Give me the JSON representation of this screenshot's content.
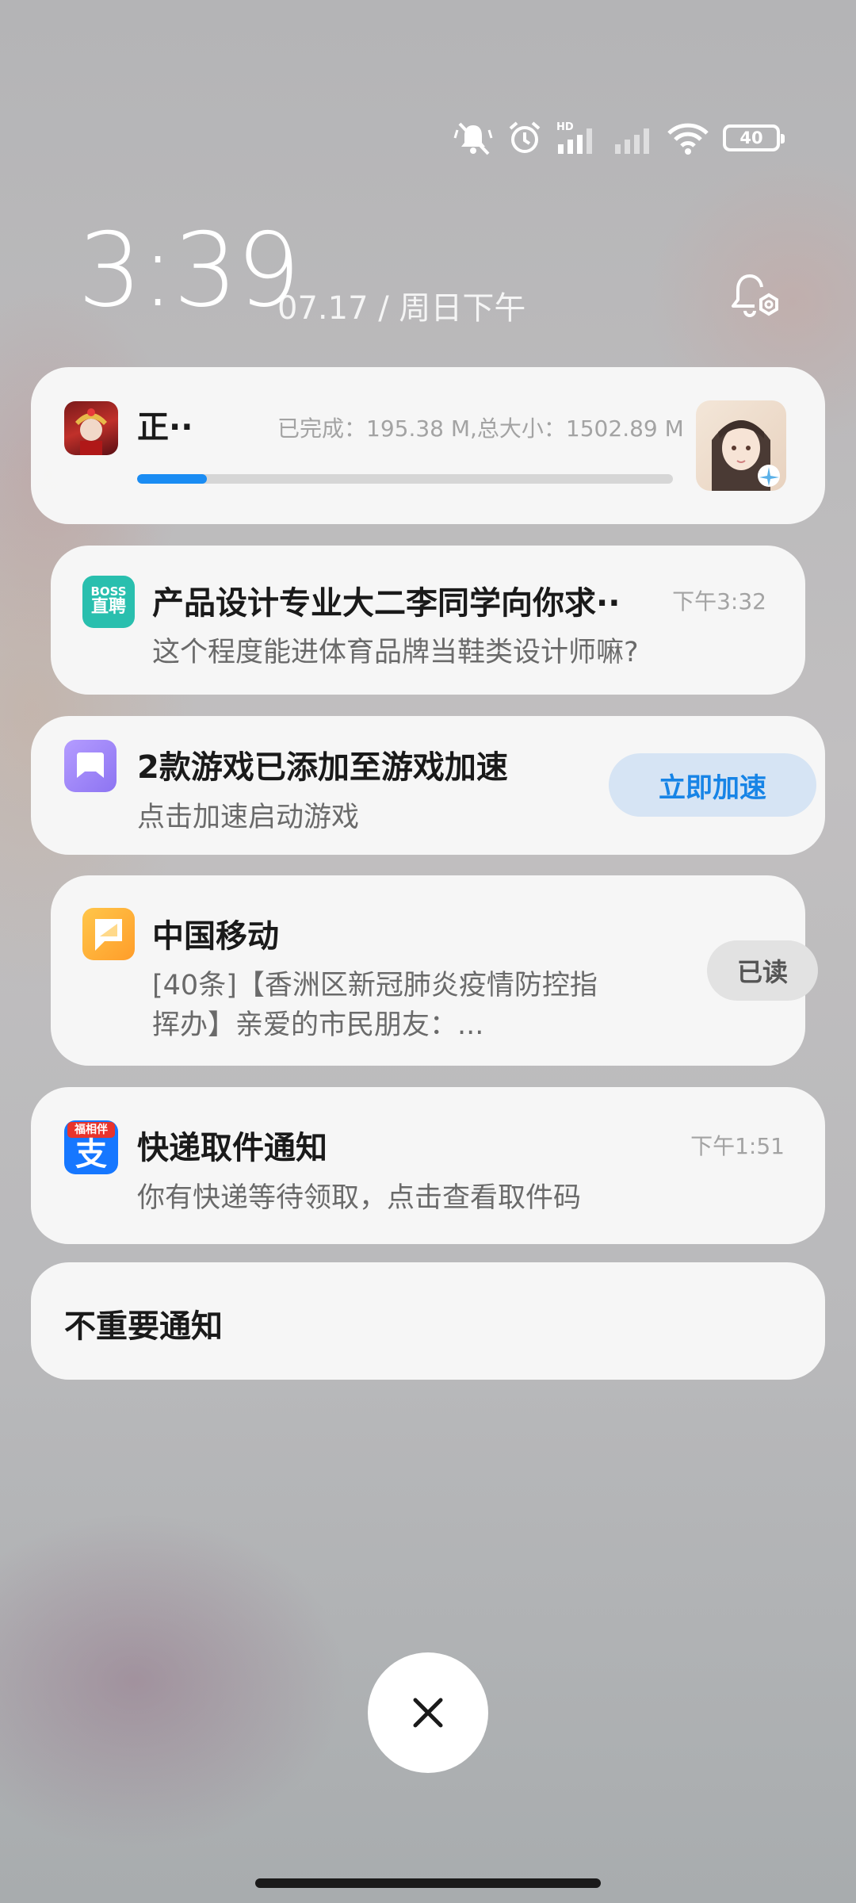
{
  "status_bar": {
    "icons": [
      "mute-vibrate-icon",
      "alarm-icon",
      "hd-signal-icon",
      "signal-icon",
      "wifi-icon"
    ],
    "hd_label": "HD",
    "battery": "40"
  },
  "clock": {
    "time": "3:39",
    "date": "07.17 / 周日下午"
  },
  "notifications": {
    "download": {
      "title": "正··",
      "stats": "已完成：195.38 M,总大小：1502.89 M",
      "progress": 0.13
    },
    "boss": {
      "icon_text_top": "BOSS",
      "icon_text_bottom": "直聘",
      "title": "产品设计专业大二李同学向你求··",
      "time": "下午3:32",
      "body": "这个程度能进体育品牌当鞋类设计师嘛?"
    },
    "game": {
      "title": "2款游戏已添加至游戏加速",
      "body": "点击加速启动游戏",
      "button": "立即加速"
    },
    "mobile": {
      "title": "中国移动",
      "body_line1": "[40条]【香洲区新冠肺炎疫情防控指",
      "body_line2": "挥办】亲爱的市民朋友：...",
      "button": "已读"
    },
    "express": {
      "icon_badge": "福相伴",
      "icon_char": "支",
      "title": "快递取件通知",
      "time": "下午1:51",
      "body": "你有快递等待领取，点击查看取件码"
    },
    "unimportant": {
      "title": "不重要通知"
    }
  },
  "colors": {
    "accent_blue": "#1a8cf3",
    "button_blue_text": "#1784e6",
    "boss_teal": "#29bfae",
    "game_purple": "#9a86f6",
    "mobile_orange": "#ffb43a",
    "alipay_blue": "#1677ff"
  }
}
